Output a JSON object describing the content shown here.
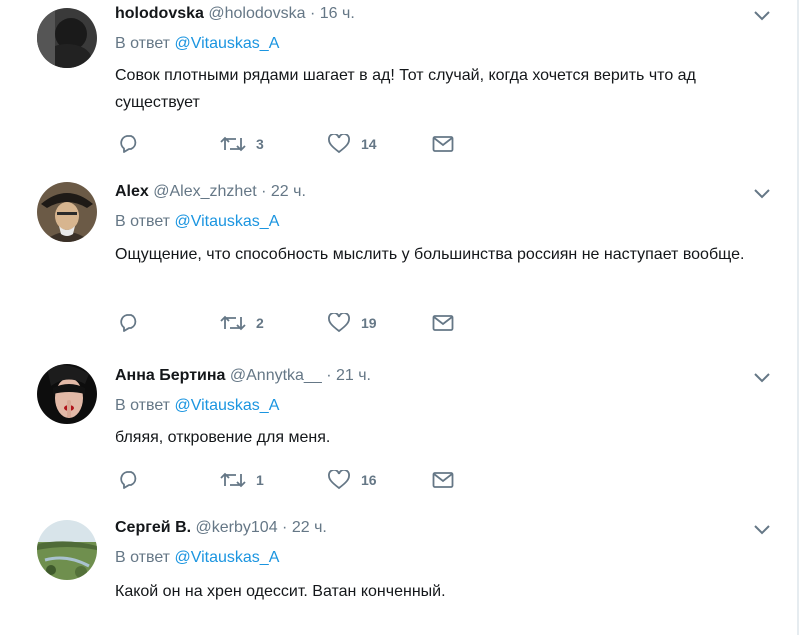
{
  "tweets": [
    {
      "name": "holodovska",
      "handle": "@holodovska",
      "time": "16 ч.",
      "reply_prefix": "В ответ",
      "reply_to": "@Vitauskas_A",
      "text": "Совок плотными рядами шагает в ад! Тот случай, когда хочется верить что ад существует",
      "retweets": "3",
      "likes": "14",
      "avatar_icon": "dark-avatar-image"
    },
    {
      "name": "Alex",
      "handle": "@Alex_zhzhet",
      "time": "22 ч.",
      "reply_prefix": "В ответ",
      "reply_to": "@Vitauskas_A",
      "text": "Ощущение, что способность мыслить у большинства россиян не наступает вообще.",
      "retweets": "2",
      "likes": "19",
      "avatar_icon": "portrait-avatar-image"
    },
    {
      "name": "Анна Бертина",
      "handle": "@Annytka__",
      "time": "21 ч.",
      "reply_prefix": "В ответ",
      "reply_to": "@Vitauskas_A",
      "text": "бляяя, откровение для меня.",
      "retweets": "1",
      "likes": "16",
      "avatar_icon": "masked-woman-avatar-image"
    },
    {
      "name": "Сергей В.",
      "handle": "@kerby104",
      "time": "22 ч.",
      "reply_prefix": "В ответ",
      "reply_to": "@Vitauskas_A",
      "text": "Какой он на хрен одессит. Ватан конченный.",
      "avatar_icon": "landscape-avatar-image"
    }
  ],
  "separator": "·",
  "colors": {
    "link": "#1b95e0",
    "muted": "#657786",
    "text": "#14171a",
    "border": "#e6ecf0"
  }
}
